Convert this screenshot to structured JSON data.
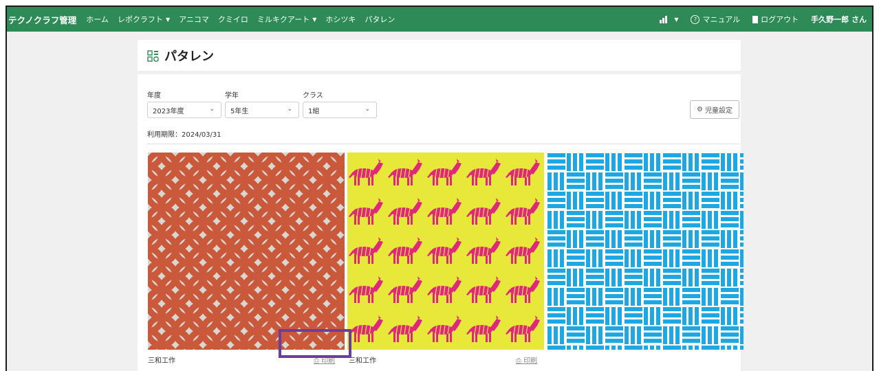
{
  "navbar": {
    "brand": "テクノクラフ管理",
    "items": [
      {
        "label": "ホーム",
        "dropdown": false
      },
      {
        "label": "レポクラフト",
        "dropdown": true
      },
      {
        "label": "アニコマ",
        "dropdown": false
      },
      {
        "label": "クミイロ",
        "dropdown": false
      },
      {
        "label": "ミルキクアート",
        "dropdown": true
      },
      {
        "label": "ホシツキ",
        "dropdown": false
      },
      {
        "label": "パタレン",
        "dropdown": false
      }
    ],
    "right": {
      "manual": "マニュアル",
      "logout": "ログアウト",
      "user": "手久野一郎 さん"
    },
    "color": "#2e8a57"
  },
  "page": {
    "title": "パタレン"
  },
  "filters": {
    "year_label": "年度",
    "year_value": "2023年度",
    "grade_label": "学年",
    "grade_value": "5年生",
    "class_label": "クラス",
    "class_value": "1組",
    "child_settings_button": "児童設定"
  },
  "expiry_text": "利用期限：2024/03/31",
  "patterns": [
    {
      "caption": "三和工作",
      "print_label": "印刷",
      "colors": [
        "#c9593a",
        "#d9d6d2"
      ]
    },
    {
      "caption": "三和工作",
      "print_label": "印刷",
      "colors": [
        "#e8e83a",
        "#e0287a"
      ]
    },
    {
      "caption": "",
      "print_label": "",
      "colors": [
        "#1ea7e0",
        "#ffffff"
      ]
    }
  ],
  "highlight_color": "#6a3ea1"
}
